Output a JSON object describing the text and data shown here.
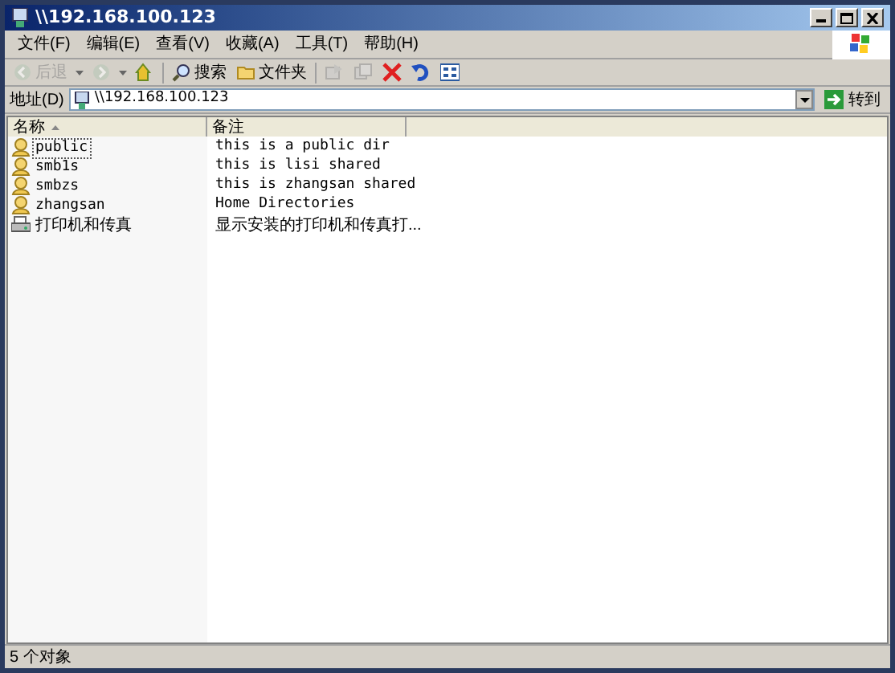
{
  "window": {
    "title": "\\\\192.168.100.123"
  },
  "menu": [
    "文件(F)",
    "编辑(E)",
    "查看(V)",
    "收藏(A)",
    "工具(T)",
    "帮助(H)"
  ],
  "toolbar": [
    {
      "kind": "back",
      "label": "后退",
      "disabled": true
    },
    {
      "kind": "forward",
      "disabled": true
    },
    {
      "kind": "up",
      "disabled": false
    },
    {
      "kind": "search",
      "label": "搜索",
      "disabled": false
    },
    {
      "kind": "folders",
      "label": "文件夹",
      "disabled": false
    },
    {
      "kind": "move",
      "disabled": true
    },
    {
      "kind": "copy",
      "disabled": true
    },
    {
      "kind": "delete",
      "disabled": false
    },
    {
      "kind": "undo",
      "disabled": false
    },
    {
      "kind": "views",
      "disabled": false
    }
  ],
  "address": {
    "label": "地址(D)",
    "value": "\\\\192.168.100.123",
    "go": "转到"
  },
  "table": {
    "columns": [
      "名称",
      "备注"
    ],
    "rows": [
      {
        "kind": "share",
        "name": "public",
        "comment": "this is a public dir",
        "focused": true
      },
      {
        "kind": "share",
        "name": "smb1s",
        "comment": "this is lisi shared",
        "focused": false
      },
      {
        "kind": "share",
        "name": "smbzs",
        "comment": "this is zhangsan shared",
        "focused": false
      },
      {
        "kind": "share",
        "name": "zhangsan",
        "comment": "Home Directories",
        "focused": false
      },
      {
        "kind": "printers",
        "name": "打印机和传真",
        "comment": "显示安装的打印机和传真打...",
        "focused": false
      }
    ]
  },
  "status_bar": "5 个对象"
}
